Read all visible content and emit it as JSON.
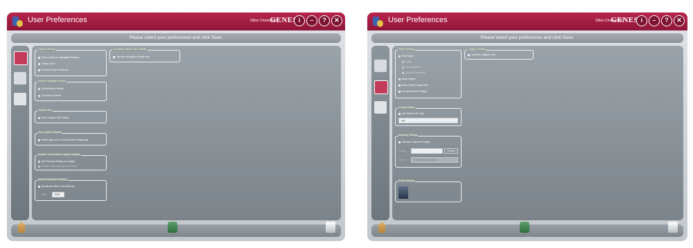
{
  "colors": {
    "titlebar": "#a31d44",
    "panel": "#8b939a"
  },
  "window": {
    "title": "User Preferences",
    "system_name": "GBox Chemi-XRQ",
    "brand": "GENESys",
    "title_buttons": [
      {
        "icon": "info-icon",
        "glyph": "i"
      },
      {
        "icon": "minimize-icon",
        "glyph": "–"
      },
      {
        "icon": "help-icon",
        "glyph": "?"
      },
      {
        "icon": "close-icon",
        "glyph": "✕"
      }
    ],
    "instruction": "Please select your preferences and click Save."
  },
  "left": {
    "general": {
      "legend": "General Settings",
      "show_labels": "Show Labels on Navigation Buttons",
      "classic_view": "Classic View",
      "prompt_save": "Prompt to Save Protocols"
    },
    "screen": {
      "legend": "Screen Changing Prompts",
      "antireflective": "Anti-reflective Screen",
      "converter": "Converter Screens"
    },
    "sample": {
      "legend": "Sample Size",
      "show_dialog": "Show Sample Size Dialog"
    },
    "autocapture": {
      "legend": "Auto Capture Defaults",
      "white_light": "White Light on for Chemi Sample Positioning"
    },
    "manual": {
      "legend": "Manual / Chemi Series Capture Defaults",
      "dynamic_range": "Use Dynamic Range for Images",
      "other": "Enable Automatic Exposure Mode"
    },
    "network": {
      "legend": "Network Broadcast Settings",
      "broadcast": "Broadcast Status Over Network",
      "port_label": "Port",
      "port_value": "8080"
    },
    "annotation": {
      "legend": "Annotation Handle Size Defaults",
      "increase": "Increase annotation handle size"
    }
  },
  "right": {
    "report": {
      "legend": "Report Settings",
      "full": "Full Report",
      "image": "Image",
      "file_navigation": "File Navigation",
      "capture_properties": "Capture Properties",
      "basic": "Basic Report",
      "basic_image": "Basic Report Image Only",
      "preview": "Preview Before Printing"
    },
    "logging": {
      "legend": "Logging Defaults",
      "increase": "Increase Logging Level"
    },
    "saving": {
      "legend": "Saving Defaults",
      "use_default": "Use Default File Type",
      "file_type": "sgd"
    },
    "autosave": {
      "legend": "Autosave Settings",
      "autosave_images": "Autosave Captured Images",
      "location_label": "Location",
      "browse": "Browse",
      "format_label": "Format",
      "format_value": "YY-MM-DD hh-mm-ss"
    },
    "printer": {
      "legend": "Printer Settings"
    }
  }
}
